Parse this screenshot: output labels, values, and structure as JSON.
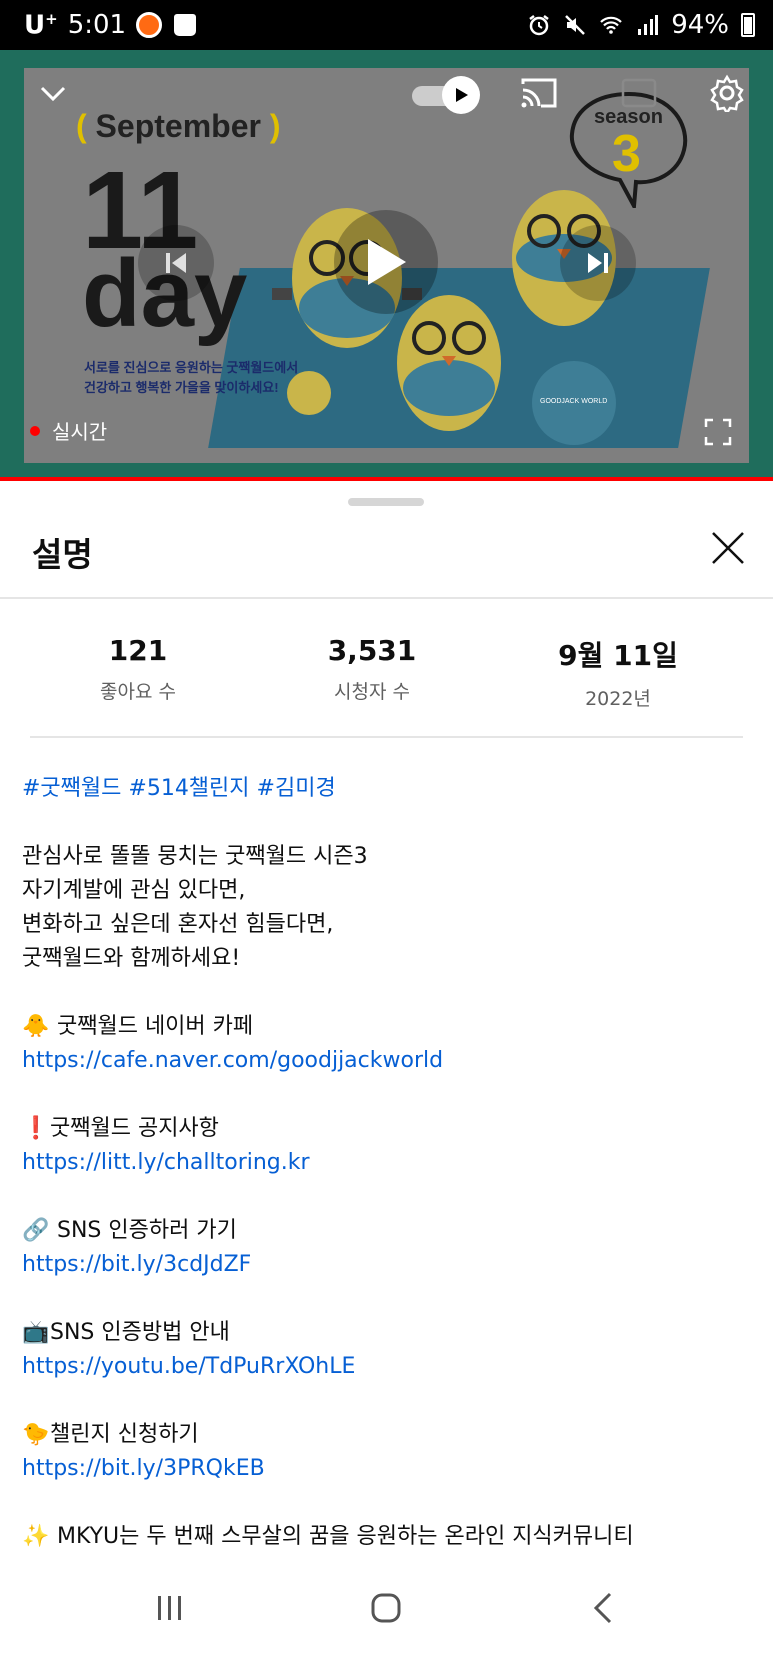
{
  "status_bar": {
    "carrier": "U",
    "carrier_sup": "+",
    "time": "5:01",
    "battery": "94%"
  },
  "video": {
    "live_label": "실시간",
    "thumbnail": {
      "month": "September",
      "day_number": "11",
      "day_word": "day",
      "slogan_line1": "서로를 진심으로 응원하는 굿짹월드에서",
      "slogan_line2": "건강하고 행복한 가을을 맞이하세요!",
      "season_word": "season",
      "season_number": "3",
      "ball_text": "GOODJACK WORLD"
    }
  },
  "sheet": {
    "title": "설명",
    "stats": [
      {
        "value": "121",
        "label": "좋아요 수"
      },
      {
        "value": "3,531",
        "label": "시청자 수"
      },
      {
        "value": "9월 11일",
        "label": "2022년"
      }
    ],
    "hashtags": "#굿짹월드 #514챌린지 #김미경",
    "intro": [
      "관심사로 똘똘 뭉치는 굿짹월드 시즌3",
      "자기계발에 관심 있다면,",
      "변화하고 싶은데 혼자선 힘들다면,",
      "굿짹월드와 함께하세요!"
    ],
    "links": [
      {
        "emoji": "🐥",
        "label": " 굿짹월드 네이버 카페",
        "url": "https://cafe.naver.com/goodjjackworld"
      },
      {
        "emoji": "❗",
        "label": "굿짹월드 공지사항",
        "url": "https://litt.ly/challtoring.kr"
      },
      {
        "emoji": "🔗",
        "label": " SNS 인증하러 가기",
        "url": "https://bit.ly/3cdJdZF"
      },
      {
        "emoji": "📺",
        "label": "SNS 인증방법 안내",
        "url": "https://youtu.be/TdPuRrXOhLE"
      },
      {
        "emoji": "🐤",
        "label": "챌린지 신청하기",
        "url": "https://bit.ly/3PRQkEB"
      }
    ],
    "last_line": {
      "emoji": "✨",
      "text": " MKYU는 두 번째 스무살의 꿈을 응원하는 온라인 지식커뮤니티"
    }
  },
  "icons": {
    "collapse": "chevron-down-icon",
    "cast": "cast-icon",
    "captions": "captions-icon",
    "settings": "gear-icon",
    "close": "close-icon"
  }
}
